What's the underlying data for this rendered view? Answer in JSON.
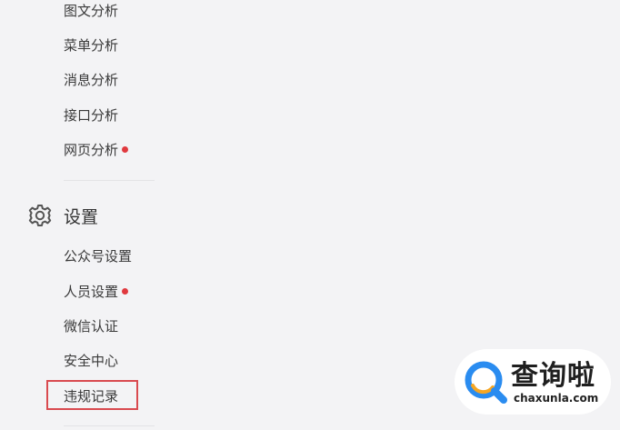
{
  "menu": {
    "analysis_items": [
      {
        "label": "图文分析",
        "dot": false
      },
      {
        "label": "菜单分析",
        "dot": false
      },
      {
        "label": "消息分析",
        "dot": false
      },
      {
        "label": "接口分析",
        "dot": false
      },
      {
        "label": "网页分析",
        "dot": true
      }
    ],
    "settings_section": {
      "title": "设置",
      "icon": "gear-icon",
      "items": [
        {
          "label": "公众号设置",
          "dot": false
        },
        {
          "label": "人员设置",
          "dot": true
        },
        {
          "label": "微信认证",
          "dot": false
        },
        {
          "label": "安全中心",
          "dot": false
        },
        {
          "label": "违规记录",
          "dot": false,
          "highlighted": true
        }
      ]
    }
  },
  "watermark": {
    "text": "查询啦",
    "sub": "chaxunla.com"
  },
  "colors": {
    "background": "#f3f3f5",
    "notification_dot": "#e0393e",
    "highlight_border": "#d94a4f",
    "logo_blue": "#2a8cf0",
    "logo_orange": "#f6a623"
  }
}
